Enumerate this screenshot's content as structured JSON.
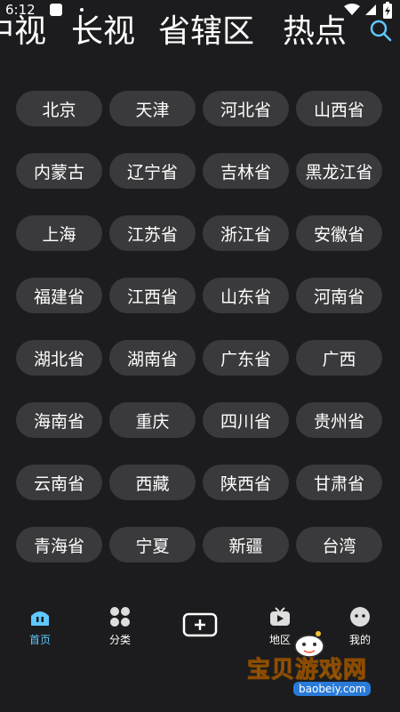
{
  "status_bar": {
    "time": "6:12"
  },
  "top_tabs": [
    {
      "label": "中视"
    },
    {
      "label": "长视"
    },
    {
      "label": "省辖区"
    },
    {
      "label": "热点"
    }
  ],
  "regions": [
    "北京",
    "天津",
    "河北省",
    "山西省",
    "内蒙古",
    "辽宁省",
    "吉林省",
    "黑龙江省",
    "上海",
    "江苏省",
    "浙江省",
    "安徽省",
    "福建省",
    "江西省",
    "山东省",
    "河南省",
    "湖北省",
    "湖南省",
    "广东省",
    "广西",
    "海南省",
    "重庆",
    "四川省",
    "贵州省",
    "云南省",
    "西藏",
    "陕西省",
    "甘肃省",
    "青海省",
    "宁夏",
    "新疆",
    "台湾"
  ],
  "bottom_nav": {
    "home": "首页",
    "category": "分类",
    "region": "地区",
    "mine": "我的"
  },
  "watermark": {
    "name": "宝贝游戏网",
    "url": "baobeiy.com"
  },
  "colors": {
    "background": "#1c1c1e",
    "chip": "#3a3a3c",
    "accent": "#5ec8ff"
  }
}
